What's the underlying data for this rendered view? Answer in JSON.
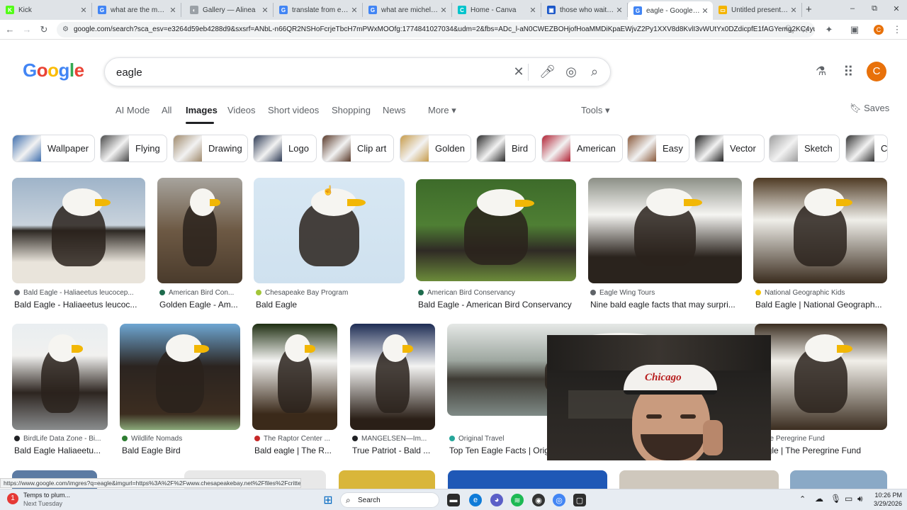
{
  "browser": {
    "tabs": [
      {
        "title": "Kick",
        "favicon_color": "#53fc18",
        "favicon_glyph": "K"
      },
      {
        "title": "what are the most bo",
        "favicon_color": "#4285f4",
        "favicon_glyph": "G"
      },
      {
        "title": "Gallery — Alinea",
        "favicon_color": "#9aa0a6",
        "favicon_glyph": "◐"
      },
      {
        "title": "translate from englisl",
        "favicon_color": "#4285f4",
        "favicon_glyph": "G"
      },
      {
        "title": "what are michelin star",
        "favicon_color": "#4285f4",
        "favicon_glyph": "G"
      },
      {
        "title": "Home - Canva",
        "favicon_color": "#00c4cc",
        "favicon_glyph": "C"
      },
      {
        "title": "those who wait on th",
        "favicon_color": "#1a56c8",
        "favicon_glyph": "▣"
      },
      {
        "title": "eagle - Google Searc",
        "favicon_color": "#4285f4",
        "favicon_glyph": "G"
      },
      {
        "title": "Untitled presentation",
        "favicon_color": "#f4b400",
        "favicon_glyph": "▭"
      }
    ],
    "new_tab": "+",
    "window_controls": [
      "–",
      "⧉",
      "✕"
    ],
    "url": "google.com/search?sca_esv=e3264d59eb4288d9&sxsrf=ANbL-n66QR2NSHoFcrjeTbcH7mPWxMOOfg:1774841027034&udm=2&fbs=ADc_l-aN0CWEZBOHjofHoaMMDiKpaEWjvZ2Py1XXV8d8KvlI3vWUtYx0DZdicpfE1fAGYemg2KC4yuMPyQIlvl...",
    "profile_initial": "C"
  },
  "google": {
    "logo": {
      "letters": [
        {
          "ch": "G",
          "color": "#4285f4"
        },
        {
          "ch": "o",
          "color": "#ea4335"
        },
        {
          "ch": "o",
          "color": "#fbbc05"
        },
        {
          "ch": "g",
          "color": "#4285f4"
        },
        {
          "ch": "l",
          "color": "#34a853"
        },
        {
          "ch": "e",
          "color": "#ea4335"
        }
      ]
    },
    "query": "eagle",
    "avatar_initial": "C",
    "tabs": [
      "AI Mode",
      "All",
      "Images",
      "Videos",
      "Short videos",
      "Shopping",
      "News",
      "More"
    ],
    "active_tab": "Images",
    "tools_label": "Tools",
    "saves_label": "Saves",
    "chips": [
      "Wallpaper",
      "Flying",
      "Drawing",
      "Logo",
      "Clip art",
      "Golden",
      "Bird",
      "American",
      "Easy",
      "Vector",
      "Sketch",
      "C"
    ]
  },
  "results_row1": [
    {
      "source": "Bald Eagle - Haliaeetus leucocep...",
      "title": "Bald Eagle - Haliaeetus leucoc...",
      "dot": "#5f6368"
    },
    {
      "source": "American Bird Con...",
      "title": "Golden Eagle - Am...",
      "dot": "#1e6b4d"
    },
    {
      "source": "Chesapeake Bay Program",
      "title": "Bald Eagle",
      "dot": "#a3c639"
    },
    {
      "source": "American Bird Conservancy",
      "title": "Bald Eagle - American Bird Conservancy",
      "dot": "#1e6b4d"
    },
    {
      "source": "Eagle Wing Tours",
      "title": "Nine bald eagle facts that may surpri...",
      "dot": "#5f6368"
    },
    {
      "source": "National Geographic Kids",
      "title": "Bald Eagle | National Geograph...",
      "dot": "#f7c500"
    }
  ],
  "results_row2": [
    {
      "source": "BirdLife Data Zone - Bi...",
      "title": "Bald Eagle Haliaeetu...",
      "dot": "#202124"
    },
    {
      "source": "Wildlife Nomads",
      "title": "Bald Eagle Bird",
      "dot": "#2e7d32"
    },
    {
      "source": "The Raptor Center ...",
      "title": "Bald eagle | The R...",
      "dot": "#c62828"
    },
    {
      "source": "MANGELSEN—Im...",
      "title": "True Patriot - Bald ...",
      "dot": "#202124"
    },
    {
      "source": "Original Travel",
      "title": "Top Ten Eagle Facts | Orig",
      "dot": "#26a69a"
    },
    {
      "source": "he Peregrine Fund",
      "title": "Eagle | The Peregrine Fund",
      "dot": "#202124"
    }
  ],
  "status_url": "https://www.google.com/imgres?q=eagle&imgurl=https%3A%2F%2Fwww.chesapeakebay.net%2Ffiles%2Fcritters%2...",
  "webcam_cap_text": "Chicago",
  "taskbar": {
    "weather_title": "Temps to plum...",
    "weather_sub": "Next Tuesday",
    "search_label": "Search",
    "time": "10:26 PM",
    "date": "3/29/2026",
    "notif_badge": "1"
  }
}
